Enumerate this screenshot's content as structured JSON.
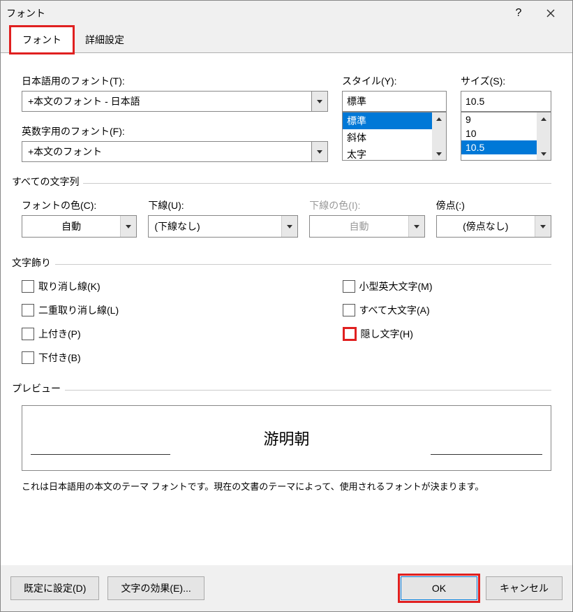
{
  "title": "フォント",
  "tabs": {
    "font": "フォント",
    "advanced": "詳細設定"
  },
  "jp_font_label": "日本語用のフォント(T):",
  "jp_font_value": "+本文のフォント - 日本語",
  "latin_font_label": "英数字用のフォント(F):",
  "latin_font_value": "+本文のフォント",
  "style_label": "スタイル(Y):",
  "style_value": "標準",
  "style_options": [
    "標準",
    "斜体",
    "太字"
  ],
  "size_label": "サイズ(S):",
  "size_value": "10.5",
  "size_options": [
    "9",
    "10",
    "10.5"
  ],
  "all_text_label": "すべての文字列",
  "font_color_label": "フォントの色(C):",
  "font_color_value": "自動",
  "underline_label": "下線(U):",
  "underline_value": "(下線なし)",
  "underline_color_label": "下線の色(I):",
  "underline_color_value": "自動",
  "emphasis_label": "傍点(:)",
  "emphasis_value": "(傍点なし)",
  "effects_label": "文字飾り",
  "chk": {
    "strike": "取り消し線(K)",
    "dstrike": "二重取り消し線(L)",
    "sup": "上付き(P)",
    "sub": "下付き(B)",
    "small": "小型英大文字(M)",
    "upper": "すべて大文字(A)",
    "hidden": "隠し文字(H)"
  },
  "preview_label": "プレビュー",
  "preview_text": "游明朝",
  "preview_note": "これは日本語用の本文のテーマ フォントです。現在の文書のテーマによって、使用されるフォントが決まります。",
  "btn": {
    "default": "既定に設定(D)",
    "effects": "文字の効果(E)...",
    "ok": "OK",
    "cancel": "キャンセル"
  }
}
